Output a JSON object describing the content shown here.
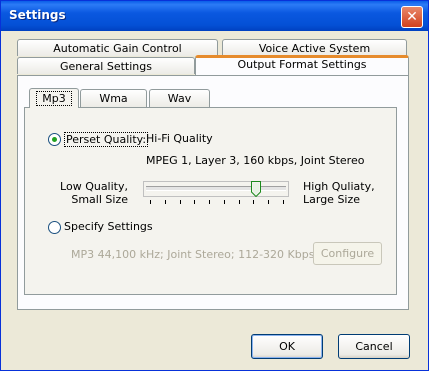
{
  "window": {
    "title": "Settings"
  },
  "tabs_row1": [
    {
      "label": "Automatic Gain Control"
    },
    {
      "label": "Voice Active System"
    }
  ],
  "tabs_row2": [
    {
      "label": "General Settings"
    },
    {
      "label": "Output Format Settings",
      "active": true
    }
  ],
  "format_tabs": [
    {
      "label": "Mp3",
      "active": true
    },
    {
      "label": "Wma"
    },
    {
      "label": "Wav"
    }
  ],
  "preset": {
    "label": "Perset Quality:",
    "selected": true,
    "value": "Hi-Fi Quality",
    "description": "MPEG 1, Layer 3, 160 kbps, Joint Stereo"
  },
  "quality_slider": {
    "low_label_line1": "Low Quality,",
    "low_label_line2": "Small Size",
    "high_label_line1": "High Quliaty,",
    "high_label_line2": "Large Size",
    "position": 0.8,
    "ticks": 10
  },
  "specify": {
    "label": "Specify Settings",
    "selected": false,
    "summary": "MP3 44,100 kHz; Joint Stereo;  112-320 Kbps;",
    "configure_label": "Configure"
  },
  "buttons": {
    "ok": "OK",
    "cancel": "Cancel"
  },
  "colors": {
    "title_bar": "#0a58e0",
    "active_tab_accent": "#e68b2c",
    "radio_dot": "#21a121",
    "disabled_text": "#aca899"
  }
}
